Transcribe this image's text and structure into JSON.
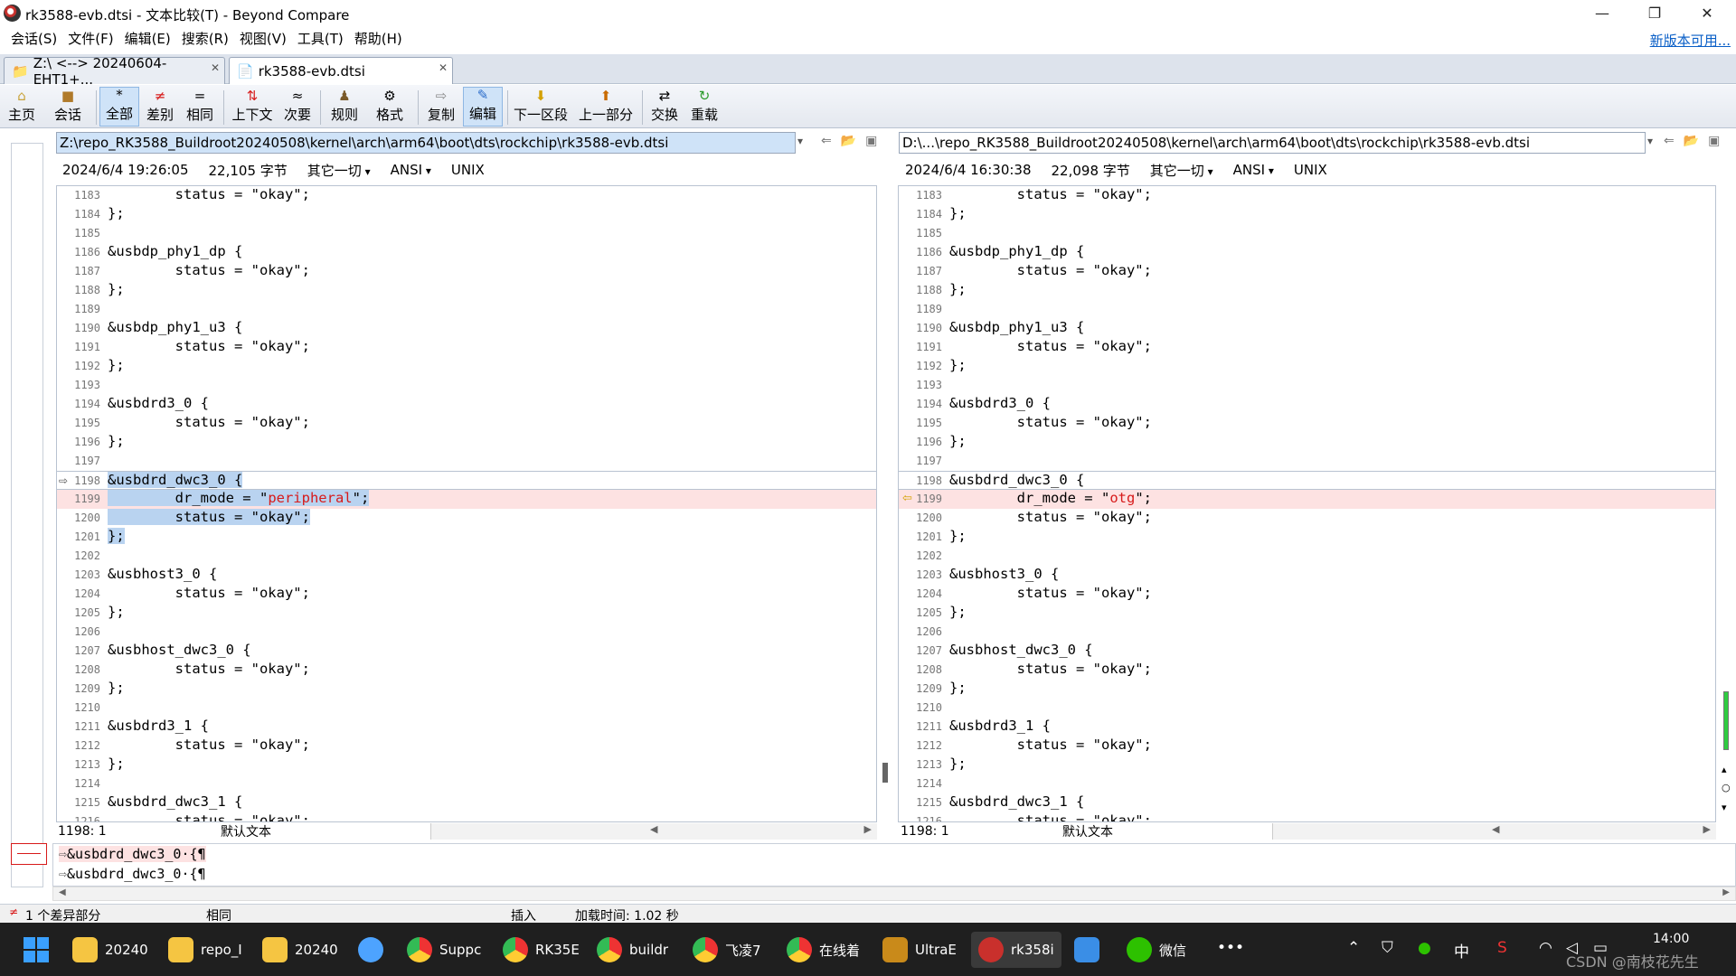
{
  "window": {
    "title": "rk3588-evb.dtsi - 文本比较(T) - Beyond Compare",
    "minimize": "—",
    "maximize": "❐",
    "close": "✕"
  },
  "menu": {
    "items": [
      "会话(S)",
      "文件(F)",
      "编辑(E)",
      "搜索(R)",
      "视图(V)",
      "工具(T)",
      "帮助(H)"
    ],
    "update_link": "新版本可用..."
  },
  "tabs": [
    {
      "label": "Z:\\ <--> 20240604-EHT1+..."
    },
    {
      "label": "rk3588-evb.dtsi"
    }
  ],
  "toolbar": {
    "items": [
      "主页",
      "会话",
      "全部",
      "差别",
      "相同",
      "上下文",
      "次要",
      "规则",
      "格式",
      "复制",
      "编辑",
      "下一区段",
      "上一部分",
      "交换",
      "重载"
    ]
  },
  "left": {
    "path": "Z:\\repo_RK3588_Buildroot20240508\\kernel\\arch\\arm64\\boot\\dts\\rockchip\\rk3588-evb.dtsi",
    "date": "2024/6/4 19:26:05",
    "size": "22,105 字节",
    "other": "其它一切",
    "encoding": "ANSI",
    "eol": "UNIX",
    "cursor": "1198: 1",
    "mode": "默认文本",
    "lines": [
      {
        "n": "1183",
        "t": "        status = \"okay\";"
      },
      {
        "n": "1184",
        "t": "};"
      },
      {
        "n": "1185",
        "t": ""
      },
      {
        "n": "1186",
        "t": "&usbdp_phy1_dp {"
      },
      {
        "n": "1187",
        "t": "        status = \"okay\";"
      },
      {
        "n": "1188",
        "t": "};"
      },
      {
        "n": "1189",
        "t": ""
      },
      {
        "n": "1190",
        "t": "&usbdp_phy1_u3 {"
      },
      {
        "n": "1191",
        "t": "        status = \"okay\";"
      },
      {
        "n": "1192",
        "t": "};"
      },
      {
        "n": "1193",
        "t": ""
      },
      {
        "n": "1194",
        "t": "&usbdrd3_0 {"
      },
      {
        "n": "1195",
        "t": "        status = \"okay\";"
      },
      {
        "n": "1196",
        "t": "};"
      },
      {
        "n": "1197",
        "t": ""
      },
      {
        "n": "1198",
        "t": "&usbdrd_dwc3_0 {"
      },
      {
        "n": "1199",
        "pre": "        dr_mode = \"",
        "red": "peripheral",
        "post": "\";"
      },
      {
        "n": "1200",
        "t": "        status = \"okay\";"
      },
      {
        "n": "1201",
        "t": "};"
      },
      {
        "n": "1202",
        "t": ""
      },
      {
        "n": "1203",
        "t": "&usbhost3_0 {"
      },
      {
        "n": "1204",
        "t": "        status = \"okay\";"
      },
      {
        "n": "1205",
        "t": "};"
      },
      {
        "n": "1206",
        "t": ""
      },
      {
        "n": "1207",
        "t": "&usbhost_dwc3_0 {"
      },
      {
        "n": "1208",
        "t": "        status = \"okay\";"
      },
      {
        "n": "1209",
        "t": "};"
      },
      {
        "n": "1210",
        "t": ""
      },
      {
        "n": "1211",
        "t": "&usbdrd3_1 {"
      },
      {
        "n": "1212",
        "t": "        status = \"okay\";"
      },
      {
        "n": "1213",
        "t": "};"
      },
      {
        "n": "1214",
        "t": ""
      },
      {
        "n": "1215",
        "t": "&usbdrd_dwc3_1 {"
      },
      {
        "n": "1216",
        "t": "        status = \"okay\";"
      }
    ]
  },
  "right": {
    "path": "D:\\...\\repo_RK3588_Buildroot20240508\\kernel\\arch\\arm64\\boot\\dts\\rockchip\\rk3588-evb.dtsi",
    "date": "2024/6/4 16:30:38",
    "size": "22,098 字节",
    "other": "其它一切",
    "encoding": "ANSI",
    "eol": "UNIX",
    "cursor": "1198: 1",
    "mode": "默认文本",
    "lines": [
      {
        "n": "1183",
        "t": "        status = \"okay\";"
      },
      {
        "n": "1184",
        "t": "};"
      },
      {
        "n": "1185",
        "t": ""
      },
      {
        "n": "1186",
        "t": "&usbdp_phy1_dp {"
      },
      {
        "n": "1187",
        "t": "        status = \"okay\";"
      },
      {
        "n": "1188",
        "t": "};"
      },
      {
        "n": "1189",
        "t": ""
      },
      {
        "n": "1190",
        "t": "&usbdp_phy1_u3 {"
      },
      {
        "n": "1191",
        "t": "        status = \"okay\";"
      },
      {
        "n": "1192",
        "t": "};"
      },
      {
        "n": "1193",
        "t": ""
      },
      {
        "n": "1194",
        "t": "&usbdrd3_0 {"
      },
      {
        "n": "1195",
        "t": "        status = \"okay\";"
      },
      {
        "n": "1196",
        "t": "};"
      },
      {
        "n": "1197",
        "t": ""
      },
      {
        "n": "1198",
        "t": "&usbdrd_dwc3_0 {"
      },
      {
        "n": "1199",
        "pre": "        dr_mode = \"",
        "red": "otg",
        "post": "\";"
      },
      {
        "n": "1200",
        "t": "        status = \"okay\";"
      },
      {
        "n": "1201",
        "t": "};"
      },
      {
        "n": "1202",
        "t": ""
      },
      {
        "n": "1203",
        "t": "&usbhost3_0 {"
      },
      {
        "n": "1204",
        "t": "        status = \"okay\";"
      },
      {
        "n": "1205",
        "t": "};"
      },
      {
        "n": "1206",
        "t": ""
      },
      {
        "n": "1207",
        "t": "&usbhost_dwc3_0 {"
      },
      {
        "n": "1208",
        "t": "        status = \"okay\";"
      },
      {
        "n": "1209",
        "t": "};"
      },
      {
        "n": "1210",
        "t": ""
      },
      {
        "n": "1211",
        "t": "&usbdrd3_1 {"
      },
      {
        "n": "1212",
        "t": "        status = \"okay\";"
      },
      {
        "n": "1213",
        "t": "};"
      },
      {
        "n": "1214",
        "t": ""
      },
      {
        "n": "1215",
        "t": "&usbdrd_dwc3_1 {"
      },
      {
        "n": "1216",
        "t": "        status = \"okay\";"
      }
    ]
  },
  "bottom": {
    "line1": "&usbdrd_dwc3_0·{¶",
    "line2": "&usbdrd_dwc3_0·{¶"
  },
  "status": {
    "diffs": "1 个差异部分",
    "same": "相同",
    "insert": "插入",
    "load_time": "加载时间: 1.02 秒"
  },
  "taskbar": {
    "items": [
      "20240",
      "repo_I",
      "20240",
      "",
      "Suppc",
      "RK35E",
      "buildr",
      "飞凌7",
      "在线着",
      "UltraE",
      "rk358i",
      "",
      "微信"
    ],
    "ime": "中",
    "time": "14:00",
    "watermark": "CSDN @南枝花先生"
  },
  "colors": {
    "diff_bg": "#fde2e2",
    "selection": "#b9d3f0",
    "diff_text": "#d71a1a",
    "link": "#0a5fc7"
  }
}
